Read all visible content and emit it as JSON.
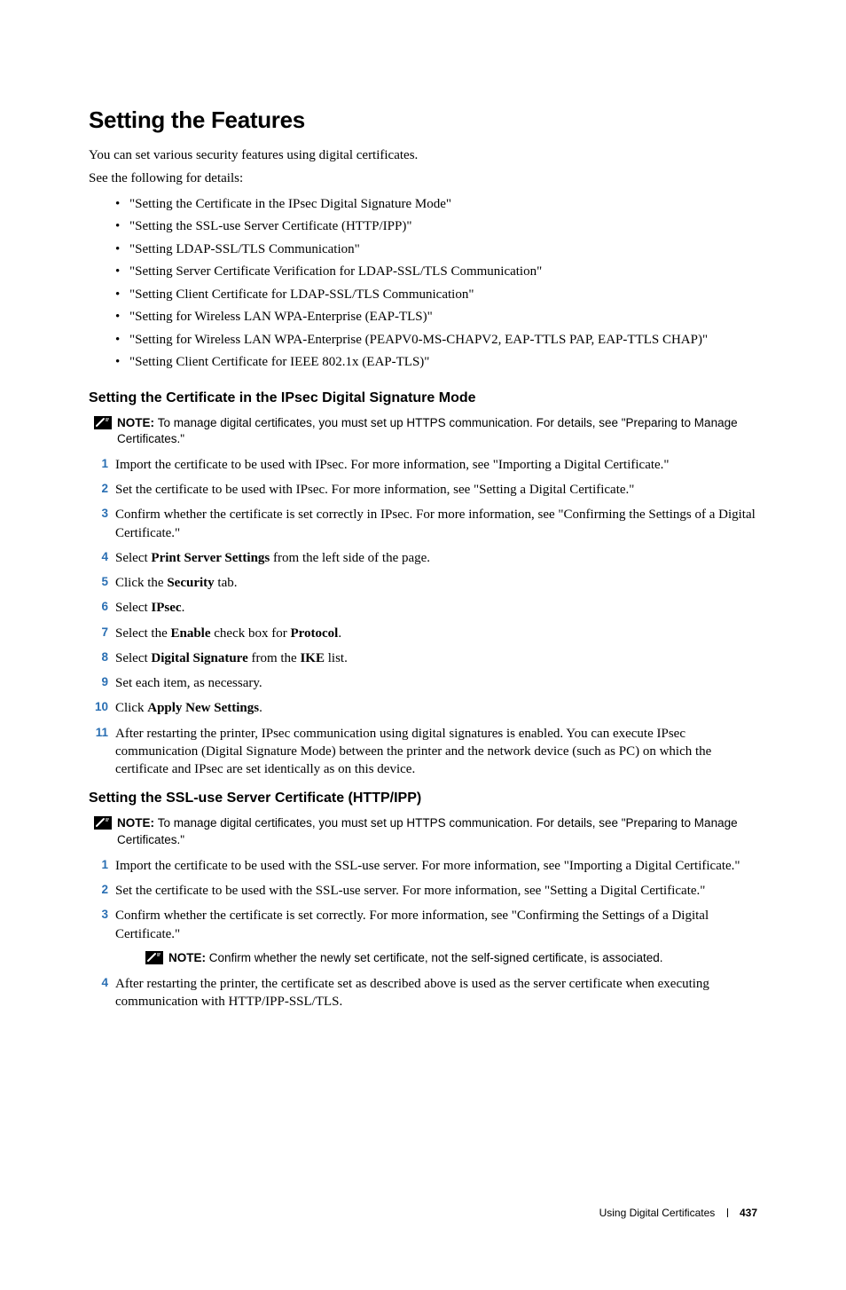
{
  "section": {
    "title": "Setting the Features",
    "intro1": "You can set various security features using digital certificates.",
    "intro2": "See the following for details:",
    "toc": [
      "\"Setting the Certificate in the IPsec Digital Signature Mode\"",
      "\"Setting the SSL-use Server Certificate (HTTP/IPP)\"",
      "\"Setting LDAP-SSL/TLS Communication\"",
      "\"Setting Server Certificate Verification for LDAP-SSL/TLS Communication\"",
      "\"Setting Client Certificate for LDAP-SSL/TLS Communication\"",
      "\"Setting for Wireless LAN WPA-Enterprise (EAP-TLS)\"",
      "\"Setting for Wireless LAN WPA-Enterprise (PEAPV0-MS-CHAPV2, EAP-TTLS PAP, EAP-TTLS CHAP)\"",
      "\"Setting Client Certificate for IEEE 802.1x (EAP-TLS)\""
    ]
  },
  "note_label": "NOTE: ",
  "sub1": {
    "title": "Setting the Certificate in the IPsec Digital Signature Mode",
    "note": "To manage digital certificates, you must set up HTTPS communication. For details, see \"Preparing to Manage Certificates.\"",
    "steps": [
      {
        "n": "1",
        "pre": "Import the certificate to be used with IPsec. For more information, see \"Importing a Digital Certificate.\""
      },
      {
        "n": "2",
        "pre": "Set the certificate to be used with IPsec. For more information, see \"Setting a Digital Certificate.\""
      },
      {
        "n": "3",
        "pre": "Confirm whether the certificate is set correctly in IPsec. For more information, see \"Confirming the Settings of a Digital Certificate.\""
      },
      {
        "n": "4",
        "pre": "Select ",
        "b1": "Print Server Settings",
        "post1": " from the left side of the page."
      },
      {
        "n": "5",
        "pre": "Click the ",
        "b1": "Security",
        "post1": " tab."
      },
      {
        "n": "6",
        "pre": "Select ",
        "b1": "IPsec",
        "post1": "."
      },
      {
        "n": "7",
        "pre": "Select the ",
        "b1": "Enable",
        "post1": " check box for ",
        "b2": "Protocol",
        "post2": "."
      },
      {
        "n": "8",
        "pre": "Select ",
        "b1": "Digital Signature",
        "post1": " from the ",
        "b2": "IKE",
        "post2": " list."
      },
      {
        "n": "9",
        "pre": "Set each item, as necessary."
      },
      {
        "n": "10",
        "pre": "Click ",
        "b1": "Apply New Settings",
        "post1": "."
      },
      {
        "n": "11",
        "pre": "After restarting the printer, IPsec communication using digital signatures is enabled. You can execute IPsec communication (Digital Signature Mode) between the printer and the network device (such as PC) on which the certificate and IPsec are set identically as on this device."
      }
    ]
  },
  "sub2": {
    "title": "Setting the SSL-use Server Certificate (HTTP/IPP)",
    "note": "To manage digital certificates, you must set up HTTPS communication. For details, see \"Preparing to Manage Certificates.\"",
    "steps": [
      {
        "n": "1",
        "pre": "Import the certificate to be used with the SSL-use server. For more information, see \"Importing a Digital Certificate.\""
      },
      {
        "n": "2",
        "pre": "Set the certificate to be used with the SSL-use server. For more information, see \"Setting a Digital Certificate.\""
      },
      {
        "n": "3",
        "pre": "Confirm whether the certificate is set correctly. For more information, see \"Confirming the Settings of a Digital Certificate.\""
      }
    ],
    "note2": "Confirm whether the newly set certificate, not the self-signed certificate, is associated.",
    "step4": {
      "n": "4",
      "pre": "After restarting the printer, the certificate set as described above is used as the server certificate when executing communication with HTTP/IPP-SSL/TLS."
    }
  },
  "footer": {
    "chapter": "Using Digital Certificates",
    "page": "437"
  }
}
